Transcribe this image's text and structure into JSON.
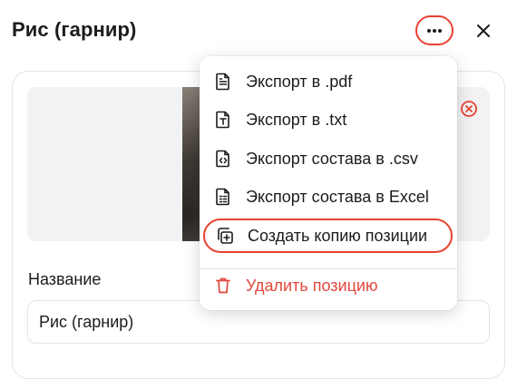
{
  "header": {
    "title": "Рис (гарнир)",
    "more_icon": "more-horizontal-icon",
    "close_icon": "close-icon"
  },
  "photo": {
    "remove_icon": "remove-circle-icon"
  },
  "form": {
    "name_label": "Название",
    "name_value": "Рис (гарнир)"
  },
  "menu": {
    "items": [
      {
        "label": "Экспорт в .pdf",
        "icon": "file-text-icon"
      },
      {
        "label": "Экспорт в .txt",
        "icon": "file-type-icon"
      },
      {
        "label": "Экспорт состава в .csv",
        "icon": "file-code-icon"
      },
      {
        "label": "Экспорт состава в Excel",
        "icon": "file-spreadsheet-icon"
      },
      {
        "label": "Создать копию позиции",
        "icon": "copy-plus-icon"
      },
      {
        "label": "Удалить позицию",
        "icon": "trash-icon"
      }
    ]
  },
  "colors": {
    "accent_red": "#e8412f",
    "danger_text": "#e0483c"
  }
}
